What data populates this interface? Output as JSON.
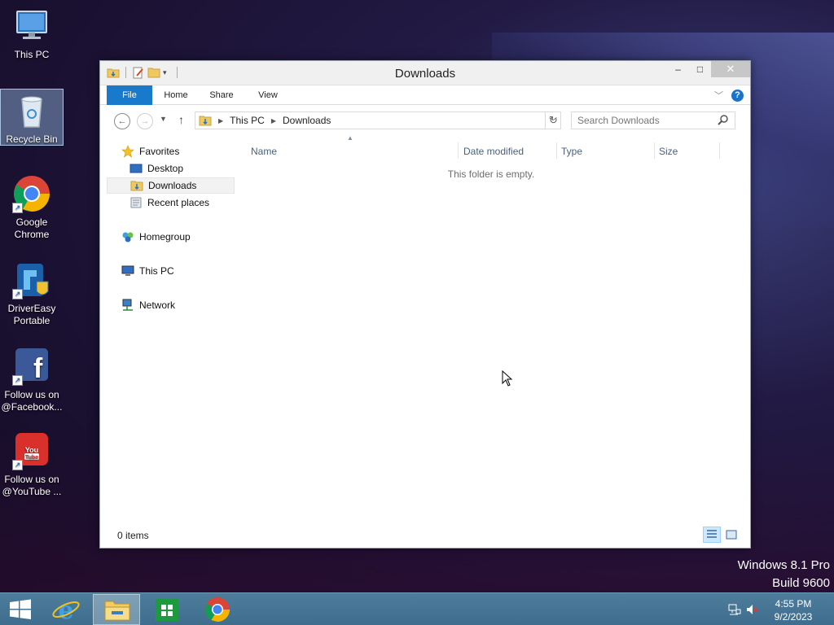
{
  "desktop": {
    "icons": [
      {
        "label": "This PC",
        "icon": "this-pc-icon"
      },
      {
        "label": "Recycle Bin",
        "icon": "recycle-bin-icon"
      },
      {
        "label": "Google Chrome",
        "icon": "chrome-icon"
      },
      {
        "label": "DriverEasy Portable",
        "icon": "drivereasy-icon"
      },
      {
        "label": "Follow us on @Facebook...",
        "icon": "facebook-icon"
      },
      {
        "label": "Follow us on @YouTube ...",
        "icon": "youtube-icon"
      }
    ],
    "watermark": {
      "line1": "Windows 8.1 Pro",
      "line2": "Build 9600"
    }
  },
  "window": {
    "title": "Downloads",
    "caption": {
      "minimize": "–",
      "maximize": "□",
      "close": "✕"
    },
    "ribbon_tabs": [
      "File",
      "Home",
      "Share",
      "View"
    ],
    "help_label": "?",
    "address": {
      "crumbs": [
        "This PC",
        "Downloads"
      ]
    },
    "search": {
      "placeholder": "Search Downloads"
    },
    "nav": {
      "favorites": "Favorites",
      "favorites_items": [
        "Desktop",
        "Downloads",
        "Recent places"
      ],
      "homegroup": "Homegroup",
      "this_pc": "This PC",
      "network": "Network"
    },
    "columns": [
      "Name",
      "Date modified",
      "Type",
      "Size"
    ],
    "empty_message": "This folder is empty.",
    "status": "0 items"
  },
  "taskbar": {
    "items": [
      "start-button",
      "internet-explorer",
      "file-explorer",
      "windows-store",
      "google-chrome"
    ],
    "active_item": "file-explorer",
    "clock": {
      "time": "4:55 PM",
      "date": "9/2/2023"
    }
  },
  "colors": {
    "accent": "#1979ca",
    "taskbar": "#4a7898",
    "selection": "#cce8ff"
  }
}
